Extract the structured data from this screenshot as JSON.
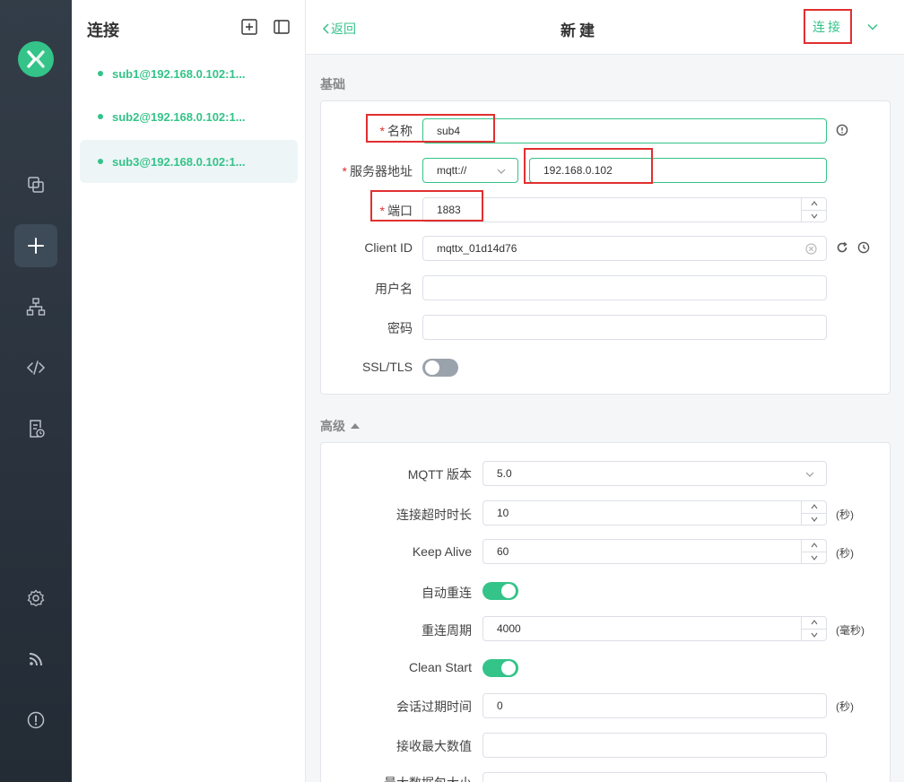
{
  "sidebar": {
    "items": [
      {
        "name": "connections-icon"
      },
      {
        "name": "new-connection-icon"
      },
      {
        "name": "topology-icon"
      },
      {
        "name": "script-icon"
      },
      {
        "name": "log-icon"
      },
      {
        "name": "settings-icon"
      },
      {
        "name": "subscribe-icon"
      },
      {
        "name": "about-icon"
      }
    ]
  },
  "connections": {
    "title": "连接",
    "items": [
      {
        "label": "sub1@192.168.0.102:1..."
      },
      {
        "label": "sub2@192.168.0.102:1..."
      },
      {
        "label": "sub3@192.168.0.102:1..."
      }
    ]
  },
  "header": {
    "back_label": "返回",
    "title": "新建",
    "connect_label": "连接"
  },
  "basic": {
    "section_label": "基础",
    "name_label": "名称",
    "name_value": "sub4",
    "host_label": "服务器地址",
    "protocol_value": "mqtt://",
    "host_value": "192.168.0.102",
    "port_label": "端口",
    "port_value": "1883",
    "client_id_label": "Client ID",
    "client_id_value": "mqttx_01d14d76",
    "username_label": "用户名",
    "username_value": "",
    "password_label": "密码",
    "password_value": "",
    "ssl_label": "SSL/TLS",
    "ssl_enabled": false
  },
  "advanced": {
    "section_label": "高级",
    "mqtt_version_label": "MQTT 版本",
    "mqtt_version_value": "5.0",
    "timeout_label": "连接超时时长",
    "timeout_value": "10",
    "timeout_unit": "(秒)",
    "keepalive_label": "Keep Alive",
    "keepalive_value": "60",
    "keepalive_unit": "(秒)",
    "auto_reconnect_label": "自动重连",
    "auto_reconnect_enabled": true,
    "reconnect_period_label": "重连周期",
    "reconnect_period_value": "4000",
    "reconnect_period_unit": "(毫秒)",
    "clean_start_label": "Clean Start",
    "clean_start_enabled": true,
    "session_expiry_label": "会话过期时间",
    "session_expiry_value": "0",
    "session_expiry_unit": "(秒)",
    "receive_max_label": "接收最大数值",
    "receive_max_value": "",
    "max_packet_label": "最大数据包大小"
  },
  "colors": {
    "accent": "#34c388",
    "highlight": "#e12f2f",
    "rail": "#2b343e"
  }
}
